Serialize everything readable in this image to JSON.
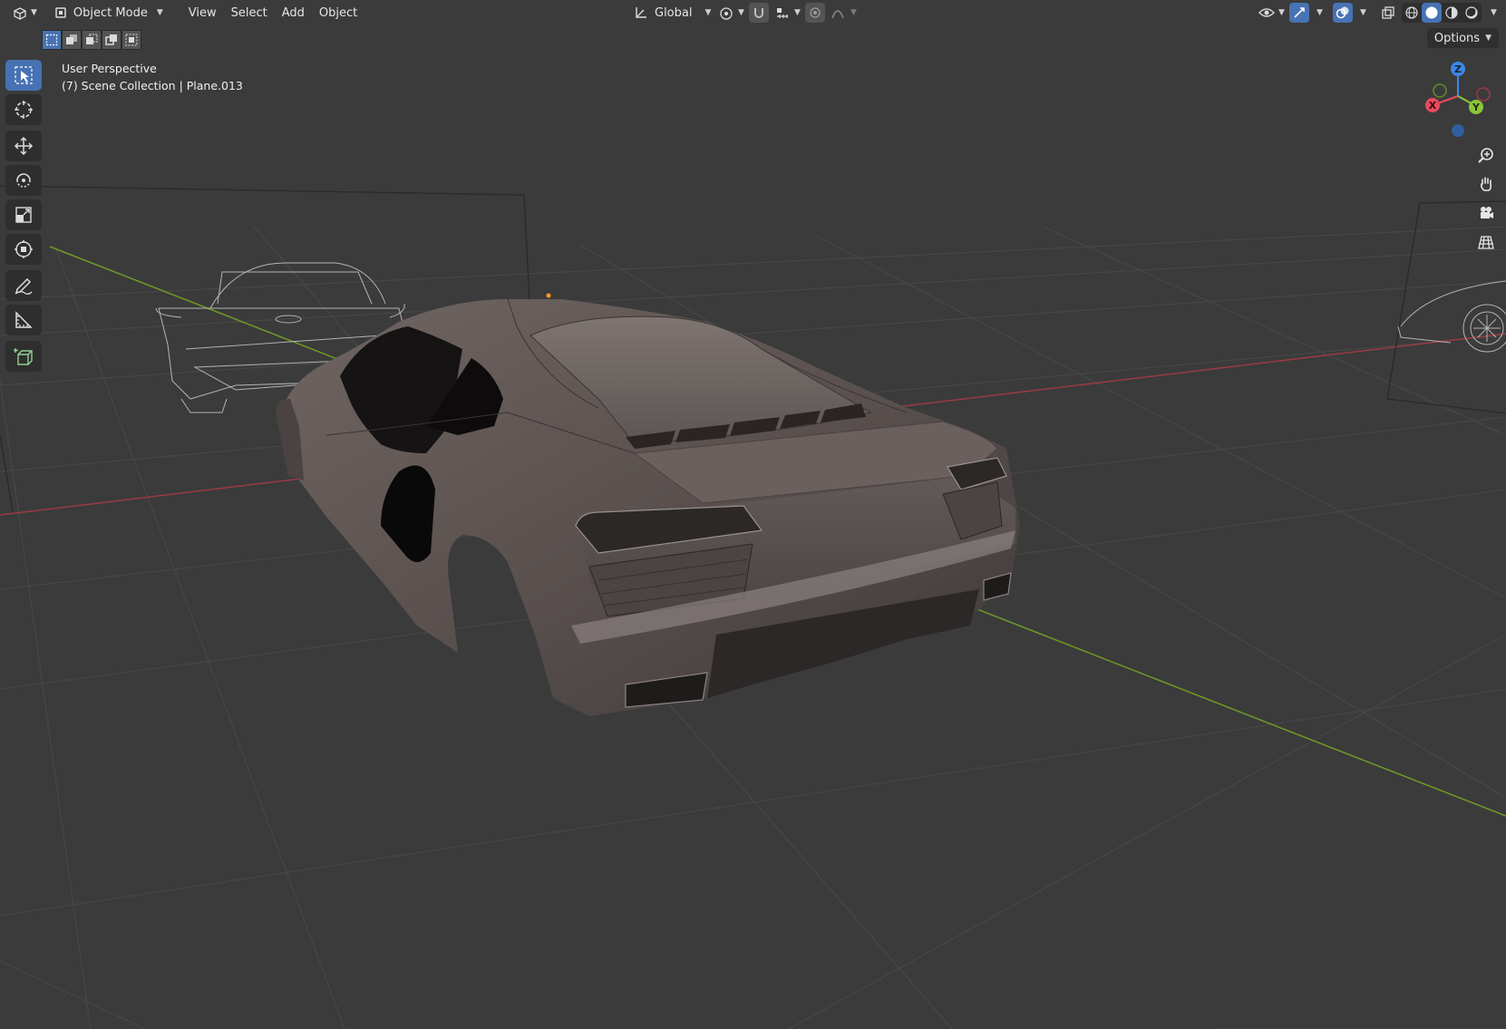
{
  "header": {
    "editor_type_icon": "viewport-editor-icon",
    "mode_label": "Object Mode",
    "menus": [
      "View",
      "Select",
      "Add",
      "Object"
    ],
    "transform_orientation": "Global"
  },
  "options_label": "Options",
  "viewport": {
    "view_name": "User Perspective",
    "collection_info": "(7) Scene Collection | Plane.013"
  },
  "toolbar": {
    "tools": [
      "select-box",
      "cursor",
      "move",
      "rotate",
      "scale",
      "transform",
      "annotate",
      "measure",
      "add-cube"
    ],
    "active_tool": "select-box"
  },
  "gizmo": {
    "z_label": "Z",
    "y_label": "Y",
    "x_label": "X",
    "colors": {
      "x": "#e84a5f",
      "y": "#8ac53a",
      "z": "#3d87e6"
    }
  },
  "colors": {
    "accent": "#4772b3",
    "background": "#3b3b3b",
    "grid_line": "#4a4a4a",
    "x_axis": "#b8434b",
    "y_axis": "#79a82c"
  }
}
